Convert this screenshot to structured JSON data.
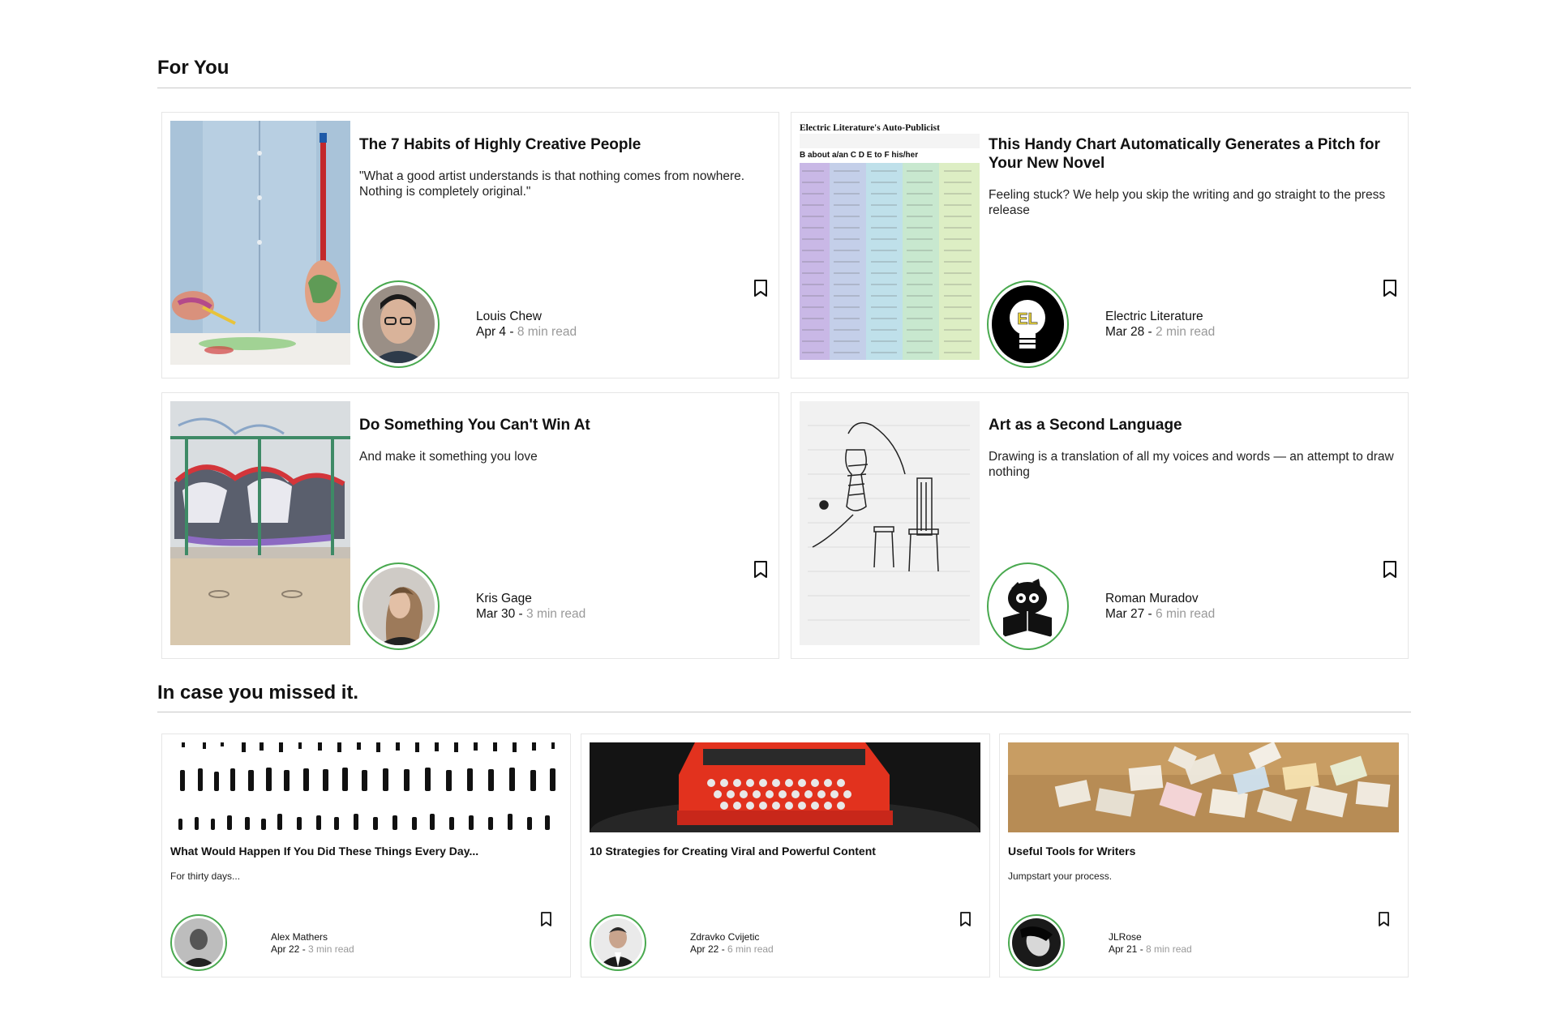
{
  "sections": {
    "for_you": "For You",
    "missed": "In case you missed it."
  },
  "for_you": [
    {
      "title": "The 7 Habits of Highly Creative People",
      "subtitle": "\"What a good artist understands is that nothing comes from nowhere. Nothing is completely original.\"",
      "author": "Louis Chew",
      "date": "Apr 4 - ",
      "read": "8 min read",
      "thumb_icon": "painted-hands-image",
      "avatar_icon": "man-glasses-avatar"
    },
    {
      "title": "This Handy Chart Automatically Generates a Pitch for Your New Novel",
      "subtitle": "Feeling stuck? We help you skip the writing and go straight to the press release",
      "author": "Electric Literature",
      "date": "Mar 28 - ",
      "read": "2 min read",
      "thumb_icon": "auto-publicist-chart-image",
      "thumb_header": "Electric Literature's Auto-Publicist",
      "thumb_cols": "B  about a/an  C  D  E  to  F  his/her",
      "avatar_icon": "lightbulb-logo-avatar",
      "avatar_text": "EL"
    },
    {
      "title": "Do Something You Can't Win At",
      "subtitle": "And make it something you love",
      "author": "Kris Gage",
      "date": "Mar 30 - ",
      "read": "3 min read",
      "thumb_icon": "graffiti-wall-image",
      "avatar_icon": "woman-avatar"
    },
    {
      "title": "Art as a Second Language",
      "subtitle": "Drawing is a translation of all my voices and words — an attempt to draw nothing",
      "author": "Roman Muradov",
      "date": "Mar 27 - ",
      "read": "6 min read",
      "thumb_icon": "sketch-drawing-image",
      "avatar_icon": "bird-reading-avatar"
    }
  ],
  "missed": [
    {
      "title": "What Would Happen If You Did These Things Every Day...",
      "subtitle": "For thirty days...",
      "author": "Alex Mathers",
      "date": "Apr 22 - ",
      "read": "3 min read",
      "thumb_icon": "tally-marks-image",
      "avatar_icon": "man-bw-avatar"
    },
    {
      "title": "10 Strategies for Creating Viral and Powerful Content",
      "subtitle": "",
      "author": "Zdravko Cvijetic",
      "date": "Apr 22 - ",
      "read": "6 min read",
      "thumb_icon": "red-typewriter-image",
      "avatar_icon": "man-suit-avatar"
    },
    {
      "title": "Useful Tools for Writers",
      "subtitle": "Jumpstart your process.",
      "author": "JLRose",
      "date": "Apr 21 - ",
      "read": "8 min read",
      "thumb_icon": "paper-pile-image",
      "avatar_icon": "person-bw-avatar"
    }
  ],
  "colors": {
    "accent_ring": "#49a94f",
    "muted": "#999999",
    "border": "#e6e6e6"
  }
}
